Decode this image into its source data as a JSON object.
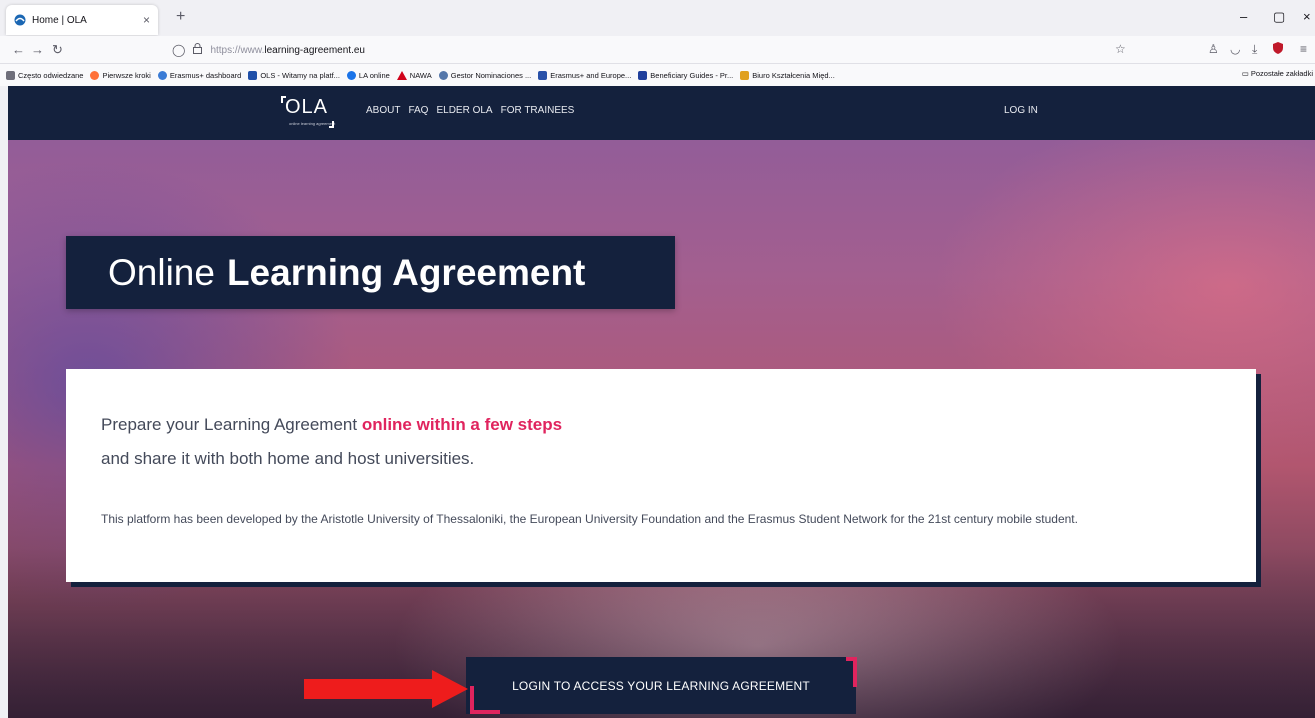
{
  "browser": {
    "tab_title": "Home | OLA",
    "tab_close": "×",
    "new_tab": "+",
    "url_proto": "https://www.",
    "url_host": "learning-agreement.eu",
    "window_controls": [
      "–",
      "▢",
      "×"
    ]
  },
  "bookmarks": {
    "items": [
      {
        "label": "Często odwiedzane",
        "color": "#6e6e7a"
      },
      {
        "label": "Pierwsze kroki",
        "color": "#ff7139"
      },
      {
        "label": "Erasmus+ dashboard",
        "color": "#3a7bd5"
      },
      {
        "label": "OLS - Witamy na platf...",
        "color": "#1f4fa8"
      },
      {
        "label": "LA online",
        "color": "#1a73e8"
      },
      {
        "label": "NAWA",
        "color": "#d0021b"
      },
      {
        "label": "Gestor Nominaciones ...",
        "color": "#5577aa"
      },
      {
        "label": "Erasmus+ and Europe...",
        "color": "#2850a8"
      },
      {
        "label": "Beneficiary Guides - Pr...",
        "color": "#1f3f9c"
      },
      {
        "label": "Biuro Kształcenia Międ...",
        "color": "#e0a020"
      }
    ],
    "other": "Pozostałe zakładki"
  },
  "site": {
    "logo": "OLA",
    "logo_sub": "online learning agreement",
    "menu": [
      "ABOUT",
      "FAQ",
      "ELDER OLA",
      "FOR TRAINEES"
    ],
    "login": "LOG IN",
    "title_light": "Online",
    "title_bold": "Learning Agreement",
    "line1_start": "Prepare your Learning Agreement ",
    "line1_accent": "online within a few steps",
    "line2": "and share it with both home and host universities.",
    "description": "This platform has been developed by the Aristotle University of Thessaloniki, the European University Foundation and the Erasmus Student Network for the 21st century mobile student.",
    "cta": "LOGIN TO ACCESS YOUR LEARNING AGREEMENT"
  },
  "colors": {
    "navy": "#14213d",
    "accent": "#e0245e",
    "arrow": "#ee1c1c"
  }
}
